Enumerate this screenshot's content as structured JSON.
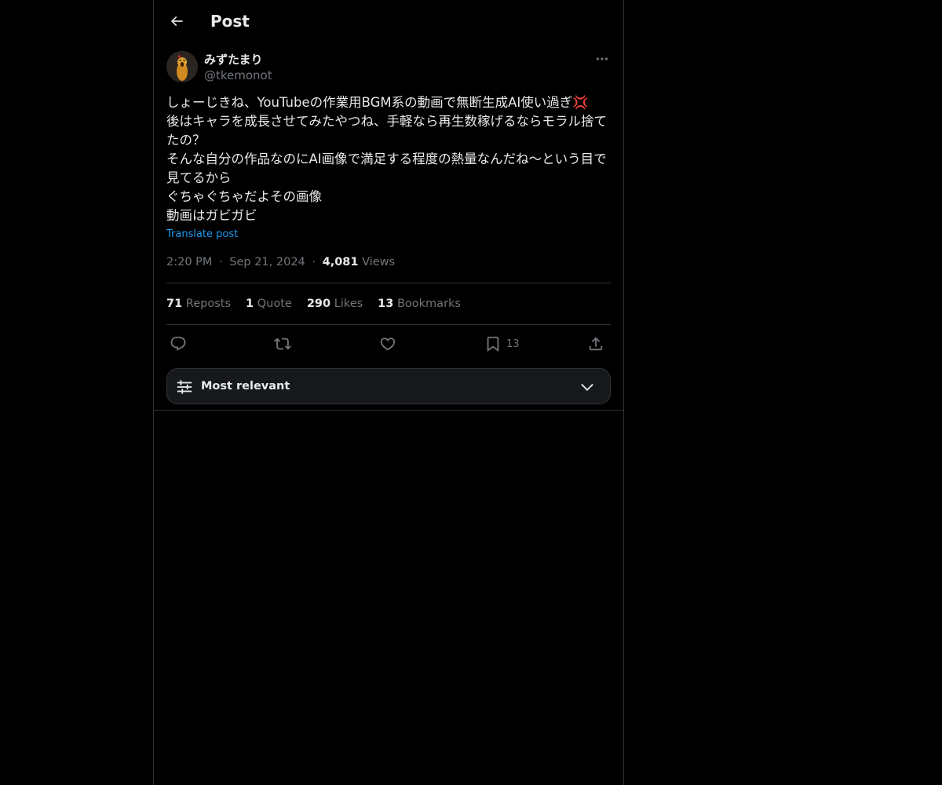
{
  "header": {
    "title": "Post",
    "back_icon": "arrow-left-icon"
  },
  "author": {
    "display_name": "みずたまり",
    "handle": "@tkemonot",
    "avatar_icon": "avatar-image"
  },
  "post": {
    "lines": [
      "しょーじきね、YouTubeの作業用BGM系の動画で無断生成AI使い過ぎ💢",
      "後はキャラを成長させてみたやつね、手軽なら再生数稼げるならモラル捨てたの？",
      "そんな自分の作品なのにAI画像で満足する程度の熱量なんだね〜という目で見てるから",
      "ぐちゃぐちゃだよその画像",
      "動画はガビガビ"
    ],
    "translate_label": "Translate post",
    "time": "2:20 PM",
    "date": "Sep 21, 2024",
    "separator": "·",
    "views_count": "4,081",
    "views_label": "Views"
  },
  "stats": {
    "reposts_count": "71",
    "reposts_label": "Reposts",
    "quotes_count": "1",
    "quotes_label": "Quote",
    "likes_count": "290",
    "likes_label": "Likes",
    "bookmarks_count": "13",
    "bookmarks_label": "Bookmarks"
  },
  "actions": {
    "reply_icon": "reply-icon",
    "repost_icon": "repost-icon",
    "like_icon": "heart-icon",
    "bookmark_icon": "bookmark-icon",
    "bookmark_count": "13",
    "share_icon": "share-icon"
  },
  "sort": {
    "label": "Most relevant",
    "icon": "sliders-icon",
    "chevron": "chevron-down-icon"
  },
  "colors": {
    "background": "#000000",
    "text": "#e7e9ea",
    "muted": "#71767b",
    "accent": "#1d9bf0",
    "border": "#2f3336"
  }
}
